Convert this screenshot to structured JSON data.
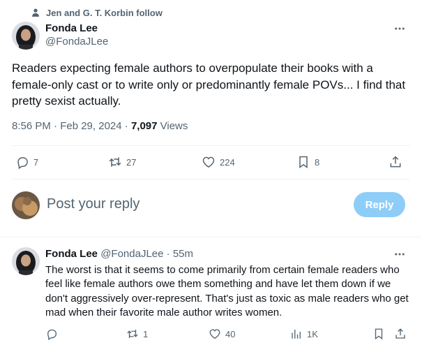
{
  "social_context": "Jen and G. T. Korbin follow",
  "tweet": {
    "author_name": "Fonda Lee",
    "author_handle": "@FondaJLee",
    "text": "Readers expecting female authors to overpopulate their books with a female-only cast or to write only or predominantly female POVs... I find that pretty sexist actually.",
    "time": "8:56 PM · Feb 29, 2024 · ",
    "views_count": "7,097",
    "views_label": " Views",
    "replies": "7",
    "retweets": "27",
    "likes": "224",
    "bookmarks": "8"
  },
  "composer": {
    "placeholder": "Post your reply",
    "button_label": "Reply"
  },
  "reply": {
    "author_name": "Fonda Lee",
    "author_handle": "@FondaJLee",
    "separator": " · ",
    "time": "55m",
    "text": "The worst is that it seems to come primarily from certain female readers who feel like female authors owe them something and have let them down if we don't aggressively over-represent. That's just as toxic as male readers who get mad when their favorite male author writes women.",
    "replies": "",
    "retweets": "1",
    "likes": "40",
    "views": "1K"
  },
  "icons": {
    "person": "person-icon",
    "more": "more-icon",
    "reply": "reply-icon",
    "retweet": "retweet-icon",
    "like": "heart-icon",
    "bookmark": "bookmark-icon",
    "share": "share-icon",
    "views": "views-icon"
  },
  "colors": {
    "reply_button": "#8ecdf8",
    "secondary_text": "#536471",
    "divider": "#eff3f4"
  }
}
